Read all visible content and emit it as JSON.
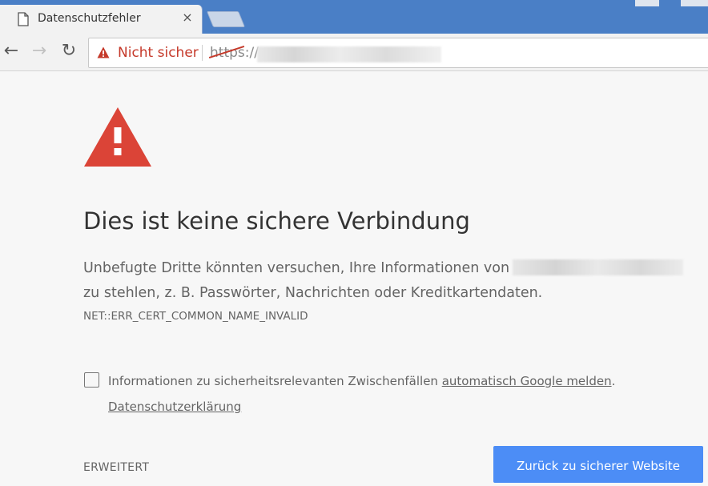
{
  "browser": {
    "tab": {
      "title": "Datenschutzfehler",
      "close_glyph": "×"
    },
    "nav": {
      "back_glyph": "←",
      "forward_glyph": "→",
      "reload_glyph": "↻"
    },
    "omnibox": {
      "security_label": "Nicht sicher",
      "scheme_struck": "https",
      "scheme_rest": "://"
    }
  },
  "interstitial": {
    "heading": "Dies ist keine sichere Verbindung",
    "body_part1": "Unbefugte Dritte könnten versuchen, Ihre Informationen von",
    "body_part2": "zu stehlen, z. B. Passwörter, Nachrichten oder Kreditkartendaten.",
    "error_code": "NET::ERR_CERT_COMMON_NAME_INVALID",
    "report": {
      "text_before": "Informationen zu sicherheitsrelevanten Zwischenfällen ",
      "link": "automatisch Google melden",
      "text_after": "."
    },
    "privacy_link": "Datenschutzerklärung",
    "advanced_button": "ERWEITERT",
    "back_button": "Zurück zu sicherer Website"
  },
  "colors": {
    "tab_strip": "#4a7fc6",
    "warning_red": "#db4437",
    "not_secure_red": "#c5392a",
    "primary_button": "#4c8df6",
    "body_text": "#646464"
  },
  "icons": {
    "tab": "document-icon",
    "omnibox": "warning-triangle-icon",
    "main": "large-warning-triangle-icon"
  }
}
